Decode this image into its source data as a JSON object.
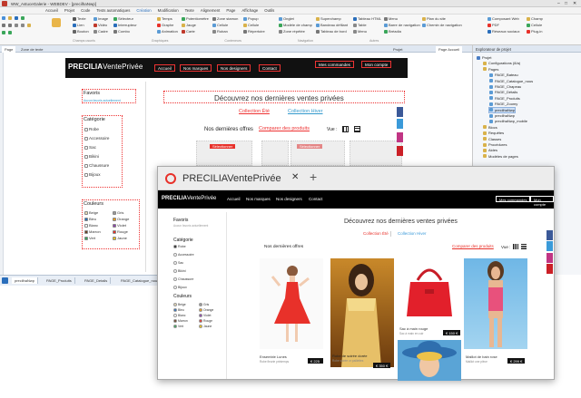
{
  "window": {
    "title": "WW_AstuceGalerie - WEBDEV - [precilhaNwp]"
  },
  "menu": [
    "Accueil",
    "Projet",
    "Code",
    "Tests automatiques",
    "Création",
    "Modification",
    "Texte",
    "Alignement",
    "Page",
    "Affichage",
    "Outils"
  ],
  "ribbon": {
    "col1": [
      "Texte",
      "Lien",
      "Bouton"
    ],
    "col2": [
      "Image",
      "Vidéo",
      "Cadre"
    ],
    "col3": [
      "Sélecteur",
      "Interrupteur",
      "Combo"
    ],
    "col4": [
      "Temps",
      "Graphe",
      "Animation"
    ],
    "col5": [
      "Potentiomètre",
      "Jauge",
      "Carte"
    ],
    "col6": [
      "Zone stamon",
      "Cellule",
      "Ruban"
    ],
    "col7": [
      "Popup",
      "Cellule",
      "Répertoire"
    ],
    "col8": [
      "Onglet",
      "Modèle de champ",
      "Zone répétée"
    ],
    "col9": [
      "Superchamp",
      "Bandeau défilant",
      "Tableau de bord"
    ],
    "col10": [
      "Tableau HTML",
      "Table",
      "Menu"
    ],
    "col11": [
      "Menu",
      "Barre de navigation",
      "Bréadia"
    ],
    "col12": [
      "Plan du site",
      "Chemin de navigation"
    ],
    "col13": [
      "Composant Web",
      "PDF",
      "Réseaux sociaux"
    ],
    "col14": [
      "Champ",
      "Cellule",
      "Plug-in"
    ],
    "group_labels": [
      "Champs usuels",
      "Graphiques",
      "Conteneurs",
      "Navigation",
      "Autres"
    ]
  },
  "doc_tabs": [
    "Page",
    "Zone de texte",
    "Projet",
    "Page Accueil"
  ],
  "editor": {
    "brand_a": "PRECILIA",
    "brand_b": "VentePrivée",
    "nav": [
      "Accueil",
      "Nos marques",
      "Nos designers",
      "Contact"
    ],
    "btn_orders": "Mes commandes",
    "btn_account": "Mon compte",
    "headline": "Découvrez nos dernières ventes privées",
    "link_ete": "Collection Été",
    "link_hiver": "Collection Hiver",
    "offers": "Nos dernières offres",
    "compare": "Comparer des produits",
    "view_label": "Vue :",
    "favoris": "Favoris",
    "favoris_sub": "Aucun favoris actuellement",
    "categorie": "Catégorie",
    "cats": [
      "Robe",
      "Accessoire",
      "Sac",
      "Bikini",
      "Chaussure",
      "Bijoux"
    ],
    "couleurs": "Couleurs",
    "colors_left": [
      "Beige",
      "Bleu",
      "Blanc",
      "Marron",
      "Vert"
    ],
    "colors_right": [
      "Gris",
      "Orange",
      "Violet",
      "Rouge",
      "Jaune"
    ],
    "select1": "Sélectionner",
    "select2": "Sélectionner"
  },
  "explorer": {
    "title": "Explorateur de projet",
    "items": [
      {
        "label": "Projet",
        "indent": 0,
        "color": "#4a7dc4"
      },
      {
        "label": "Configurations (8/a)",
        "indent": 1,
        "color": "#d9b24a"
      },
      {
        "label": "Pages",
        "indent": 1,
        "color": "#d9b24a"
      },
      {
        "label": "PAGE_Bateau",
        "indent": 2,
        "color": "#5b9bd5"
      },
      {
        "label": "PAGE_Catalogue_nous",
        "indent": 2,
        "color": "#5b9bd5"
      },
      {
        "label": "PAGE_Chapeau",
        "indent": 2,
        "color": "#5b9bd5"
      },
      {
        "label": "PAGE_Détails",
        "indent": 2,
        "color": "#5b9bd5"
      },
      {
        "label": "PAGE_Produits",
        "indent": 2,
        "color": "#5b9bd5"
      },
      {
        "label": "PAGE_Zoomy",
        "indent": 2,
        "color": "#5b9bd5"
      },
      {
        "label": "precilhaNwp",
        "indent": 2,
        "color": "#5b9bd5",
        "selected": true
      },
      {
        "label": "precilhaNwp",
        "indent": 2,
        "color": "#5b9bd5"
      },
      {
        "label": "precilhaNwp_mobile",
        "indent": 2,
        "color": "#5b9bd5"
      },
      {
        "label": "Blocs",
        "indent": 1,
        "color": "#d9b24a"
      },
      {
        "label": "Requêtes",
        "indent": 1,
        "color": "#d9b24a"
      },
      {
        "label": "Classes",
        "indent": 1,
        "color": "#d9b24a"
      },
      {
        "label": "Procédures",
        "indent": 1,
        "color": "#d9b24a"
      },
      {
        "label": "Aides",
        "indent": 1,
        "color": "#d9b24a"
      },
      {
        "label": "Modèles de pages",
        "indent": 1,
        "color": "#d9b24a"
      }
    ]
  },
  "status_tabs": [
    "precilhaNwp",
    "PAGE_Produits",
    "PAGE_Details",
    "PAGE_Catalogue_nous"
  ],
  "browser": {
    "tab_title": "PRECILIAVentePrivée",
    "close": "✕",
    "newtab": "+",
    "brand_a": "PRECILIA",
    "brand_b": "VentePrivée",
    "nav": [
      "Accueil",
      "Nos marques",
      "Nos designers",
      "Contact"
    ],
    "btn_orders": "Mes commandes",
    "btn_account": "Mon compte",
    "favoris": "Favoris",
    "favoris_sub": "Aucun favoris actuellement",
    "categorie": "Catégorie",
    "cats": [
      "Robe",
      "Accessoire",
      "Sac",
      "Bikini",
      "Chaussure",
      "Bijoux"
    ],
    "couleurs": "Couleurs",
    "colors_left": [
      "Beige",
      "Bleu",
      "Blanc",
      "Marron",
      "Vert"
    ],
    "colors_right": [
      "Gris",
      "Orange",
      "Violet",
      "Rouge",
      "Jaune"
    ],
    "headline": "Découvrez nos dernières ventes privées",
    "link_ete": "Collection Été",
    "link_hiver": "Collection Hiver",
    "offers": "Nos dernières offres",
    "compare": "Comparer des produits",
    "view_label": "Vue :",
    "products": [
      {
        "name": "Ensemble Lunes",
        "sub": "Robe fleurie printemps",
        "price": "€ 225 €"
      },
      {
        "name": "Robe de soirée dorée",
        "sub": "Robe soirée or paillettes",
        "price": "€ 350 €"
      },
      {
        "name": "Sac à main rouge",
        "sub": "Sac à main en cuir",
        "price": "€ 150 €"
      },
      {
        "name": "Maillot de bain rose",
        "sub": "Maillot une pièce",
        "price": "€ 299 €"
      }
    ]
  },
  "colors": {
    "accent": "#e8312a",
    "link_blue": "#3a9ad9",
    "black": "#000000"
  }
}
